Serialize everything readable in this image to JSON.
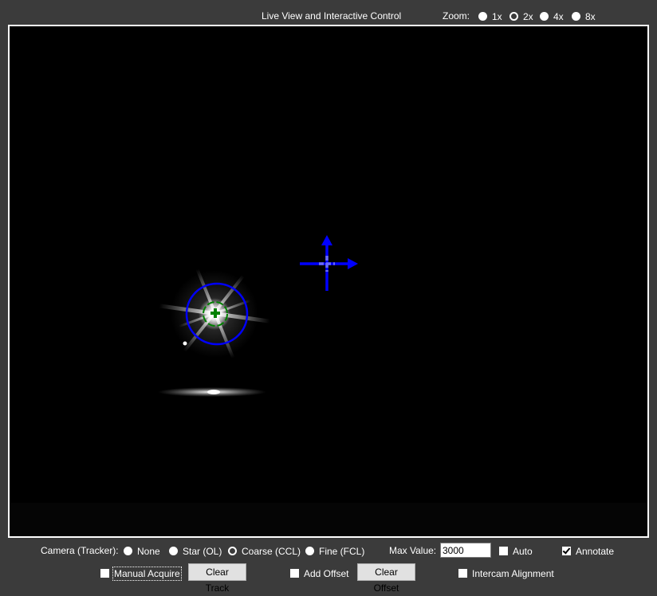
{
  "header": {
    "title": "Live View and Interactive Control",
    "zoom_label": "Zoom:",
    "zoom_options": [
      "1x",
      "2x",
      "4x",
      "8x"
    ],
    "zoom_selected": "2x"
  },
  "controls": {
    "camera_label": "Camera (Tracker):",
    "camera_options": [
      "None",
      "Star (OL)",
      "Coarse (CCL)",
      "Fine (FCL)"
    ],
    "camera_selected": "Coarse (CCL)",
    "max_value_label": "Max Value:",
    "max_value": "3000",
    "auto_label": "Auto",
    "auto_checked": false,
    "annotate_label": "Annotate",
    "annotate_checked": true,
    "manual_acquire_label": "Manual Acquire",
    "manual_acquire_checked": false,
    "clear_track_label": "Clear Track",
    "add_offset_label": "Add Offset",
    "add_offset_checked": false,
    "clear_offset_label": "Clear Offset",
    "intercam_label": "Intercam Alignment",
    "intercam_checked": false
  },
  "colors": {
    "background": "#3b3b3b",
    "view_background": "#000000",
    "crosshair": "#0000ff",
    "track_circle": "#0000ff",
    "target_marker": "#008000"
  },
  "icons": [
    "offset-arrow-up-icon",
    "offset-arrow-right-icon",
    "crosshair-icon",
    "track-marker-icon"
  ]
}
